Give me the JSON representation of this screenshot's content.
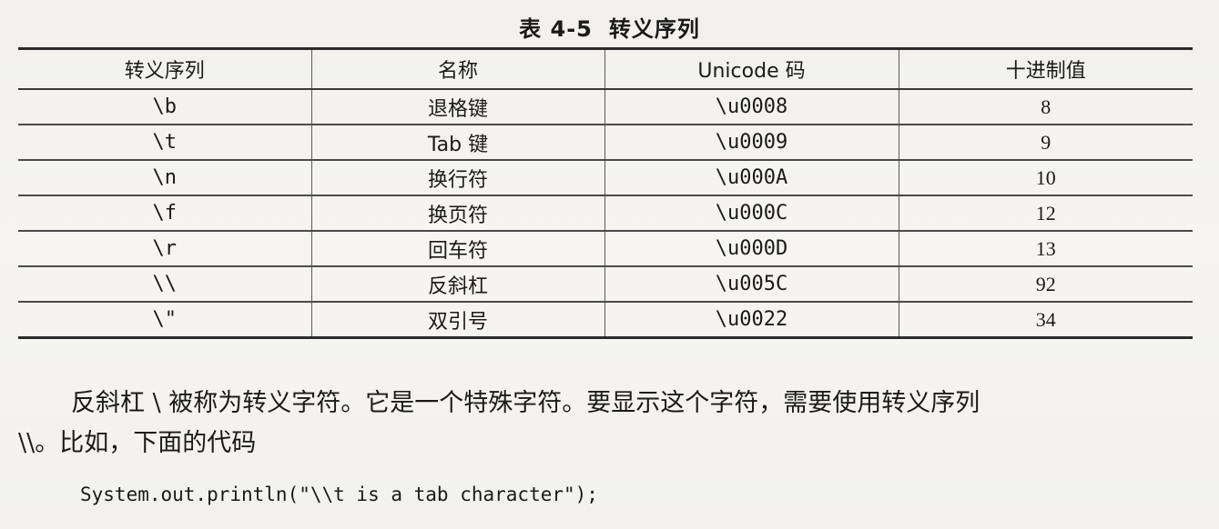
{
  "caption": {
    "number": "表 4-5",
    "title": "转义序列"
  },
  "table": {
    "headers": [
      "转义序列",
      "名称",
      "Unicode 码",
      "十进制值"
    ],
    "rows": [
      {
        "escape": "\\b",
        "name": "退格键",
        "unicode": "\\u0008",
        "decimal": "8"
      },
      {
        "escape": "\\t",
        "name": "Tab 键",
        "unicode": "\\u0009",
        "decimal": "9"
      },
      {
        "escape": "\\n",
        "name": "换行符",
        "unicode": "\\u000A",
        "decimal": "10"
      },
      {
        "escape": "\\f",
        "name": "换页符",
        "unicode": "\\u000C",
        "decimal": "12"
      },
      {
        "escape": "\\r",
        "name": "回车符",
        "unicode": "\\u000D",
        "decimal": "13"
      },
      {
        "escape": "\\\\",
        "name": "反斜杠",
        "unicode": "\\u005C",
        "decimal": "92"
      },
      {
        "escape": "\\\"",
        "name": "双引号",
        "unicode": "\\u0022",
        "decimal": "34"
      }
    ]
  },
  "body": {
    "line1": "反斜杠 \\ 被称为转义字符。它是一个特殊字符。要显示这个字符，需要使用转义序列",
    "line2": "\\\\。比如，下面的代码",
    "code": "System.out.println(\"\\\\t is a tab character\");"
  }
}
